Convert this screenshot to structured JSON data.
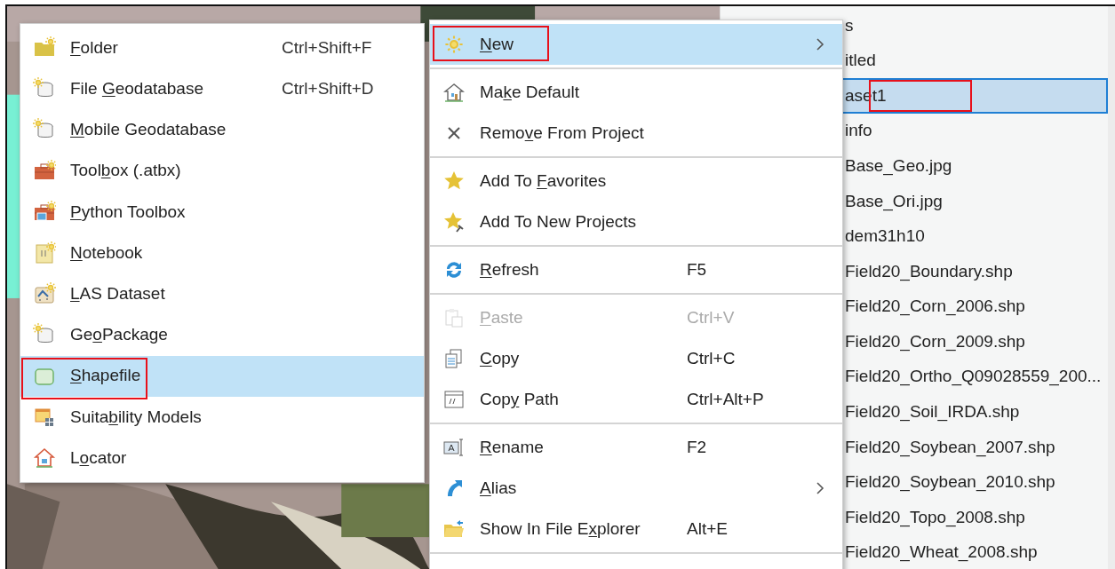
{
  "new_submenu": {
    "items": [
      {
        "label": {
          "key": "F",
          "after": "older"
        },
        "shortcut": "Ctrl+Shift+F",
        "selected": false,
        "outlined": false
      },
      {
        "label": {
          "before": "File ",
          "key": "G",
          "after": "eodatabase"
        },
        "shortcut": "Ctrl+Shift+D",
        "selected": false,
        "outlined": false
      },
      {
        "label": {
          "key": "M",
          "after": "obile Geodatabase"
        },
        "selected": false,
        "outlined": false
      },
      {
        "label": {
          "before": "Tool",
          "key": "b",
          "after": "ox (.atbx)"
        },
        "selected": false,
        "outlined": false
      },
      {
        "label": {
          "key": "P",
          "after": "ython Toolbox"
        },
        "selected": false,
        "outlined": false
      },
      {
        "label": {
          "key": "N",
          "after": "otebook"
        },
        "selected": false,
        "outlined": false
      },
      {
        "label": {
          "key": "L",
          "after": "AS Dataset"
        },
        "selected": false,
        "outlined": false
      },
      {
        "label": {
          "before": "Ge",
          "key": "o",
          "after": "Package"
        },
        "selected": false,
        "outlined": false
      },
      {
        "label": {
          "key": "S",
          "after": "hapefile"
        },
        "selected": true,
        "outlined": true
      },
      {
        "label": {
          "before": "Suita",
          "key": "b",
          "after": "ility Models"
        },
        "selected": false,
        "outlined": false
      },
      {
        "label": {
          "before": "L",
          "key": "o",
          "after": "cator"
        },
        "selected": false,
        "outlined": false
      }
    ]
  },
  "context_menu": {
    "groups": [
      [
        {
          "label": {
            "key": "N",
            "after": "ew"
          },
          "selected": true,
          "outlined": true,
          "disabled": false,
          "submenu": true
        }
      ],
      [
        {
          "label": {
            "before": "Ma",
            "key": "k",
            "after": "e Default"
          },
          "selected": false,
          "outlined": false,
          "disabled": false,
          "submenu": false
        },
        {
          "label": {
            "before": "Remo",
            "key": "v",
            "after": "e From Project"
          },
          "selected": false,
          "outlined": false,
          "disabled": false,
          "submenu": false
        }
      ],
      [
        {
          "label": {
            "before": "Add To ",
            "key": "F",
            "after": "avorites"
          },
          "selected": false,
          "outlined": false,
          "disabled": false,
          "submenu": false
        },
        {
          "label": {
            "before": "Add To New Projects"
          },
          "selected": false,
          "outlined": false,
          "disabled": false,
          "submenu": false
        }
      ],
      [
        {
          "label": {
            "key": "R",
            "after": "efresh"
          },
          "shortcut": "F5",
          "selected": false,
          "outlined": false,
          "disabled": false,
          "submenu": false
        }
      ],
      [
        {
          "label": {
            "key": "P",
            "after": "aste"
          },
          "shortcut": "Ctrl+V",
          "selected": false,
          "outlined": false,
          "disabled": true,
          "submenu": false
        },
        {
          "label": {
            "key": "C",
            "after": "opy"
          },
          "shortcut": "Ctrl+C",
          "selected": false,
          "outlined": false,
          "disabled": false,
          "submenu": false
        },
        {
          "label": {
            "before": "Cop",
            "key": "y",
            "after": " Path"
          },
          "shortcut": "Ctrl+Alt+P",
          "selected": false,
          "outlined": false,
          "disabled": false,
          "submenu": false
        }
      ],
      [
        {
          "label": {
            "key": "R",
            "after": "ename"
          },
          "shortcut": "F2",
          "selected": false,
          "outlined": false,
          "disabled": false,
          "submenu": false
        },
        {
          "label": {
            "key": "A",
            "after": "lias"
          },
          "selected": false,
          "outlined": false,
          "disabled": false,
          "submenu": true
        },
        {
          "label": {
            "before": "Show In File E",
            "key": "x",
            "after": "plorer"
          },
          "shortcut": "Alt+E",
          "selected": false,
          "outlined": false,
          "disabled": false,
          "submenu": false
        }
      ]
    ]
  },
  "catalog_list": {
    "items": [
      {
        "name": "s",
        "selected": false,
        "outlined": false
      },
      {
        "name": "itled",
        "selected": false,
        "outlined": false
      },
      {
        "name": "aset1",
        "selected": true,
        "outlined": true
      },
      {
        "name": "info",
        "selected": false,
        "outlined": false
      },
      {
        "name": "Base_Geo.jpg",
        "selected": false,
        "outlined": false
      },
      {
        "name": "Base_Ori.jpg",
        "selected": false,
        "outlined": false
      },
      {
        "name": "dem31h10",
        "selected": false,
        "outlined": false
      },
      {
        "name": "Field20_Boundary.shp",
        "selected": false,
        "outlined": false
      },
      {
        "name": "Field20_Corn_2006.shp",
        "selected": false,
        "outlined": false
      },
      {
        "name": "Field20_Corn_2009.shp",
        "selected": false,
        "outlined": false
      },
      {
        "name": "Field20_Ortho_Q09028559_200...",
        "selected": false,
        "outlined": false
      },
      {
        "name": "Field20_Soil_IRDA.shp",
        "selected": false,
        "outlined": false
      },
      {
        "name": "Field20_Soybean_2007.shp",
        "selected": false,
        "outlined": false
      },
      {
        "name": "Field20_Soybean_2010.shp",
        "selected": false,
        "outlined": false
      },
      {
        "name": "Field20_Topo_2008.shp",
        "selected": false,
        "outlined": false
      },
      {
        "name": "Field20_Wheat_2008.shp",
        "selected": false,
        "outlined": false
      }
    ]
  }
}
